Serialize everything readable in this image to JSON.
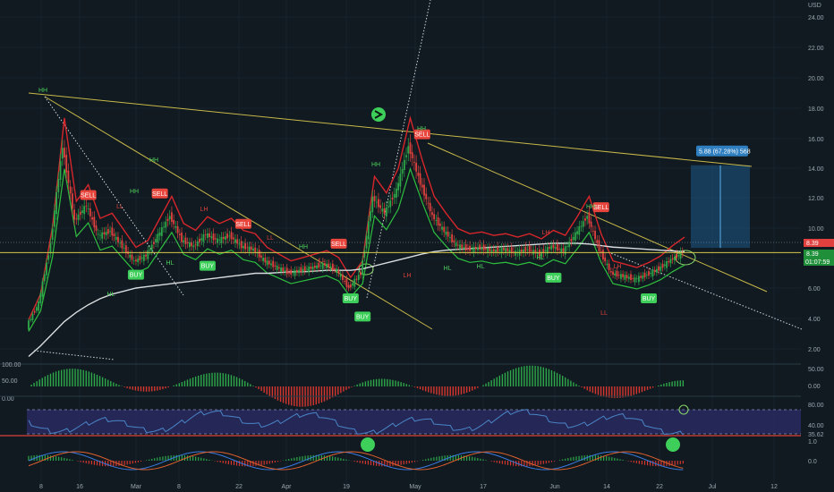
{
  "chart_data": {
    "type": "line",
    "title": "",
    "xlabel": "",
    "ylabel": "",
    "currency": "USD",
    "y_ticks": [
      "24.00",
      "22.00",
      "20.00",
      "18.00",
      "16.00",
      "14.00",
      "12.00",
      "10.00",
      "8.00",
      "6.00",
      "4.00",
      "2.00"
    ],
    "ylim": [
      1,
      24.5
    ],
    "x_ticks": [
      "8",
      "16",
      "Mar",
      "8",
      "22",
      "Apr",
      "19",
      "May",
      "17",
      "Jun",
      "14",
      "22",
      "Jul",
      "12"
    ],
    "price_labels": {
      "last": "8.39",
      "last2": "8.39",
      "countdown": "01:07:59",
      "hline": "8.39"
    },
    "measure_box": {
      "text": "5.88 (67.28%) 568",
      "from": 8.7,
      "to": 14.2
    },
    "close_series": [
      3.5,
      5.0,
      9.0,
      15.5,
      10.5,
      11.5,
      9.5,
      9.8,
      8.8,
      7.8,
      8.2,
      9.5,
      10.8,
      9.2,
      8.8,
      9.6,
      9.2,
      9.5,
      8.8,
      8.6,
      7.8,
      7.4,
      7.0,
      7.2,
      7.4,
      7.6,
      7.2,
      6.0,
      7.0,
      12.0,
      11.0,
      12.5,
      15.5,
      13.0,
      10.8,
      9.8,
      8.9,
      8.6,
      8.7,
      8.5,
      8.6,
      8.4,
      8.6,
      8.3,
      8.8,
      8.5,
      9.6,
      10.8,
      8.6,
      7.0,
      6.8,
      6.6,
      6.9,
      7.3,
      7.9,
      8.4
    ],
    "ma_series": [
      1.5,
      2.2,
      3.0,
      3.8,
      4.4,
      4.9,
      5.3,
      5.6,
      5.8,
      6.0,
      6.1,
      6.2,
      6.3,
      6.4,
      6.5,
      6.6,
      6.7,
      6.8,
      6.9,
      7.0,
      7.0,
      7.05,
      7.1,
      7.1,
      7.15,
      7.2,
      7.2,
      7.2,
      7.3,
      7.5,
      7.7,
      7.9,
      8.1,
      8.3,
      8.45,
      8.55,
      8.6,
      8.65,
      8.7,
      8.75,
      8.8,
      8.85,
      8.9,
      8.95,
      9.0,
      9.0,
      9.0,
      8.95,
      8.85,
      8.75,
      8.7,
      8.65,
      8.6,
      8.55,
      8.5,
      8.45
    ],
    "signals": [
      {
        "type": "BUY",
        "i": 9,
        "price": 7.6
      },
      {
        "type": "BUY",
        "i": 15,
        "price": 8.2
      },
      {
        "type": "BUY",
        "i": 27,
        "price": 6.0
      },
      {
        "type": "BUY",
        "i": 28,
        "price": 4.8
      },
      {
        "type": "BUY",
        "i": 44,
        "price": 7.4
      },
      {
        "type": "BUY",
        "i": 52,
        "price": 6.0
      },
      {
        "type": "SELL",
        "i": 5,
        "price": 11.5
      },
      {
        "type": "SELL",
        "i": 11,
        "price": 11.6
      },
      {
        "type": "SELL",
        "i": 18,
        "price": 9.6
      },
      {
        "type": "SELL",
        "i": 26,
        "price": 8.3
      },
      {
        "type": "SELL",
        "i": 33,
        "price": 15.6
      },
      {
        "type": "SELL",
        "i": 48,
        "price": 10.7
      }
    ],
    "pivots": [
      "HH",
      "HH",
      "HH",
      "HH",
      "HH",
      "HH",
      "HL",
      "HL",
      "HL",
      "HL",
      "LL",
      "LL",
      "LH",
      "LH",
      "LH",
      "LL",
      "HH",
      "HL",
      "LL",
      "LH"
    ],
    "oscillator_ticks": {
      "osc1": [
        "100.00",
        "50.00",
        "0.00"
      ],
      "osc1_right": [
        "50.00",
        "0.00"
      ],
      "osc2_right": [
        "80.00",
        "40.00",
        "35.62"
      ],
      "osc3_right": [
        "1.0",
        "0.0"
      ]
    }
  }
}
